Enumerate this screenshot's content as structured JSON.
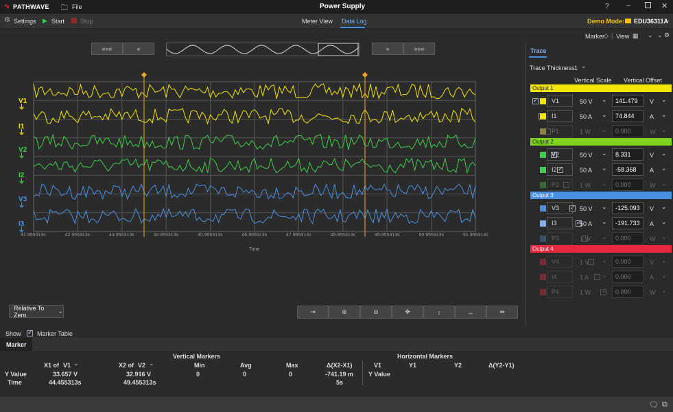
{
  "titlebar": {
    "brand": "PATHWAVE",
    "file": "File",
    "title": "Power Supply",
    "help": "?"
  },
  "toolbar": {
    "settings": "Settings",
    "start": "Start",
    "stop": "Stop",
    "tab_meter": "Meter View",
    "tab_datalog": "Data Log",
    "demo_label": "Demo Mode:",
    "instrument": "EDU36311A"
  },
  "subbar": {
    "marker": "Marker",
    "view": "View"
  },
  "plot": {
    "time_label": "Time",
    "x_ticks": [
      "41.955313s",
      "42.955313s",
      "43.955313s",
      "44.955313s",
      "45.955313s",
      "46.955313s",
      "47.955313s",
      "48.955313s",
      "49.955313s",
      "50.955313s",
      "51.955313s"
    ],
    "trace_labels": [
      "V1",
      "I1",
      "V2",
      "I2",
      "V3",
      "I3"
    ],
    "relative": "Relative To Zero"
  },
  "panel": {
    "tab": "Trace",
    "thickness_label": "Trace Thickness",
    "thickness_value": "1",
    "col_scale": "Vertical Scale",
    "col_offset": "Vertical Offset",
    "outputs": [
      {
        "name": "Output 1",
        "color": "#f2e600",
        "rows": [
          {
            "name": "V1",
            "scale": "50 V",
            "offset": "141.479",
            "unit": "V",
            "on": true,
            "color": "#f2e600"
          },
          {
            "name": "I1",
            "scale": "50 A",
            "offset": "74.844",
            "unit": "A",
            "on": true,
            "color": "#f2e600"
          },
          {
            "name": "P1",
            "scale": "1 W",
            "offset": "0.000",
            "unit": "W",
            "on": false,
            "color": "#8b8437"
          }
        ]
      },
      {
        "name": "Output 2",
        "color": "#7ed321",
        "rows": [
          {
            "name": "V2",
            "scale": "50 V",
            "offset": "8.331",
            "unit": "V",
            "on": true,
            "color": "#3ecf4a"
          },
          {
            "name": "I2",
            "scale": "50 A",
            "offset": "-58.368",
            "unit": "A",
            "on": true,
            "color": "#3ecf4a"
          },
          {
            "name": "P2",
            "scale": "1 W",
            "offset": "0.000",
            "unit": "W",
            "on": false,
            "color": "#356b3a"
          }
        ]
      },
      {
        "name": "Output 3",
        "color": "#4a90e2",
        "rows": [
          {
            "name": "V3",
            "scale": "50 V",
            "offset": "-125.093",
            "unit": "V",
            "on": true,
            "color": "#4a90e2"
          },
          {
            "name": "I3",
            "scale": "50 A",
            "offset": "-191.733",
            "unit": "A",
            "on": true,
            "color": "#7fb2f0"
          },
          {
            "name": "P3",
            "scale": "1 W",
            "offset": "0.000",
            "unit": "W",
            "on": false,
            "color": "#3b5069"
          }
        ]
      },
      {
        "name": "Output 4",
        "color": "#e8283c",
        "rows": [
          {
            "name": "V4",
            "scale": "1 V",
            "offset": "0.000",
            "unit": "V",
            "on": false,
            "color": "#7a2a33"
          },
          {
            "name": "I4",
            "scale": "1 A",
            "offset": "0.000",
            "unit": "A",
            "on": false,
            "color": "#7a2a33"
          },
          {
            "name": "P4",
            "scale": "1 W",
            "offset": "0.000",
            "unit": "W",
            "on": false,
            "color": "#7a2a33"
          }
        ]
      }
    ]
  },
  "bottom": {
    "show": "Show",
    "marker_table": "Marker Table",
    "tab": "Marker",
    "vertical_markers": "Vertical Markers",
    "horizontal_markers": "Horizontal Markers",
    "x1_of": "X1 of",
    "x1_sel": "V1",
    "x2_of": "X2 of",
    "x2_sel": "V2",
    "min": "Min",
    "avg": "Avg",
    "max": "Max",
    "delta_x": "Δ(X2-X1)",
    "hv1": "V1",
    "hy1": "Y1",
    "hy2": "Y2",
    "delta_y": "Δ(Y2-Y1)",
    "y_value": "Y Value",
    "time": "Time",
    "x1_y": "33.657 V",
    "x1_t": "44.455313s",
    "x2_y": "32.916 V",
    "x2_t": "49.455313s",
    "min_v": "0",
    "avg_v": "0",
    "max_v": "0",
    "dx_y": "-741.19 m",
    "dx_t": "5s",
    "h_yvalue": "Y Value"
  }
}
